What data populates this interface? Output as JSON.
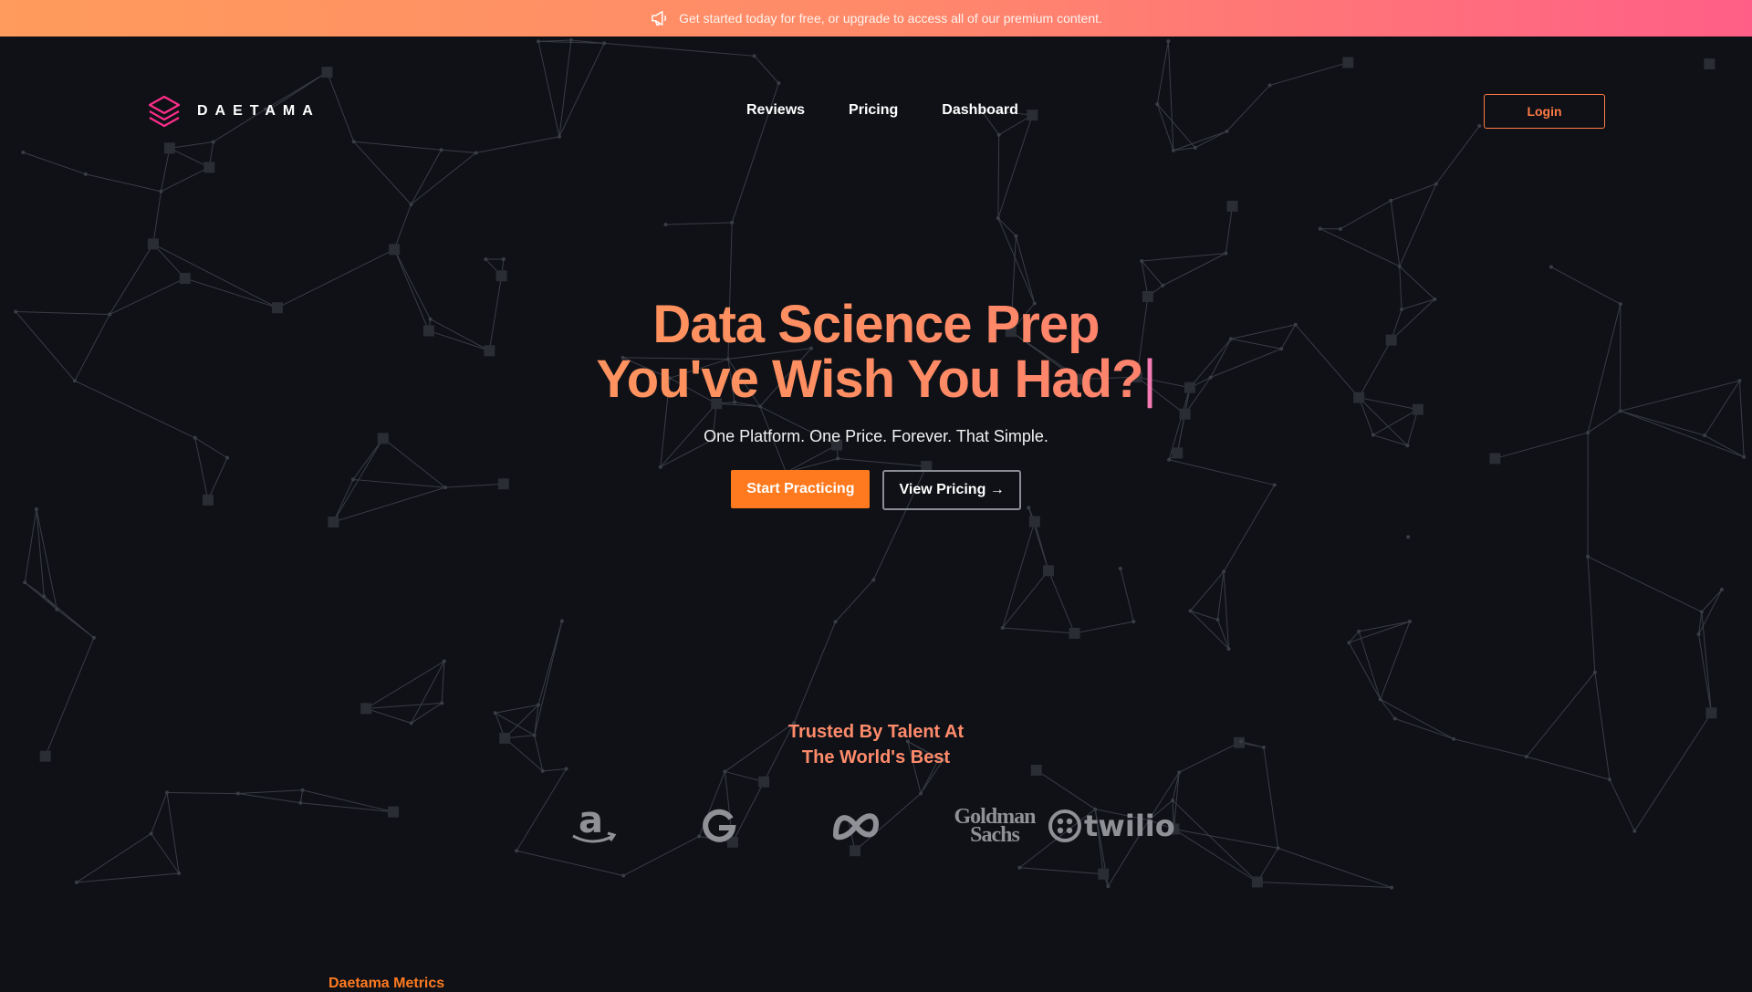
{
  "banner": {
    "icon": "megaphone-icon",
    "text": "Get started today for free, or upgrade to access all of our premium content."
  },
  "brand": {
    "name": "DAETAMA",
    "accent": "#ff2d8a"
  },
  "nav": {
    "links": [
      "Reviews",
      "Pricing",
      "Dashboard"
    ],
    "login": "Login"
  },
  "hero": {
    "title_line1": "Data Science Prep",
    "title_line2": "You've  Wish You Had?",
    "caret": "|",
    "subtitle": "One Platform. One Price. Forever. That Simple.",
    "cta_primary": "Start Practicing",
    "cta_secondary": "View Pricing →"
  },
  "trusted": {
    "line1": "Trusted By Talent At",
    "line2": "The World's Best",
    "companies": [
      "amazon-logo",
      "google-logo",
      "meta-logo",
      "goldman-sachs-logo",
      "twilio-logo"
    ],
    "goldman_line1": "Goldman",
    "goldman_line2": "Sachs",
    "twilio": "twilio"
  },
  "section_label": "Daetama Metrics",
  "colors": {
    "background": "#0f1117",
    "orange": "#ff7a1f",
    "gradient_start": "#ff9b5c",
    "gradient_end": "#ff5f87"
  }
}
